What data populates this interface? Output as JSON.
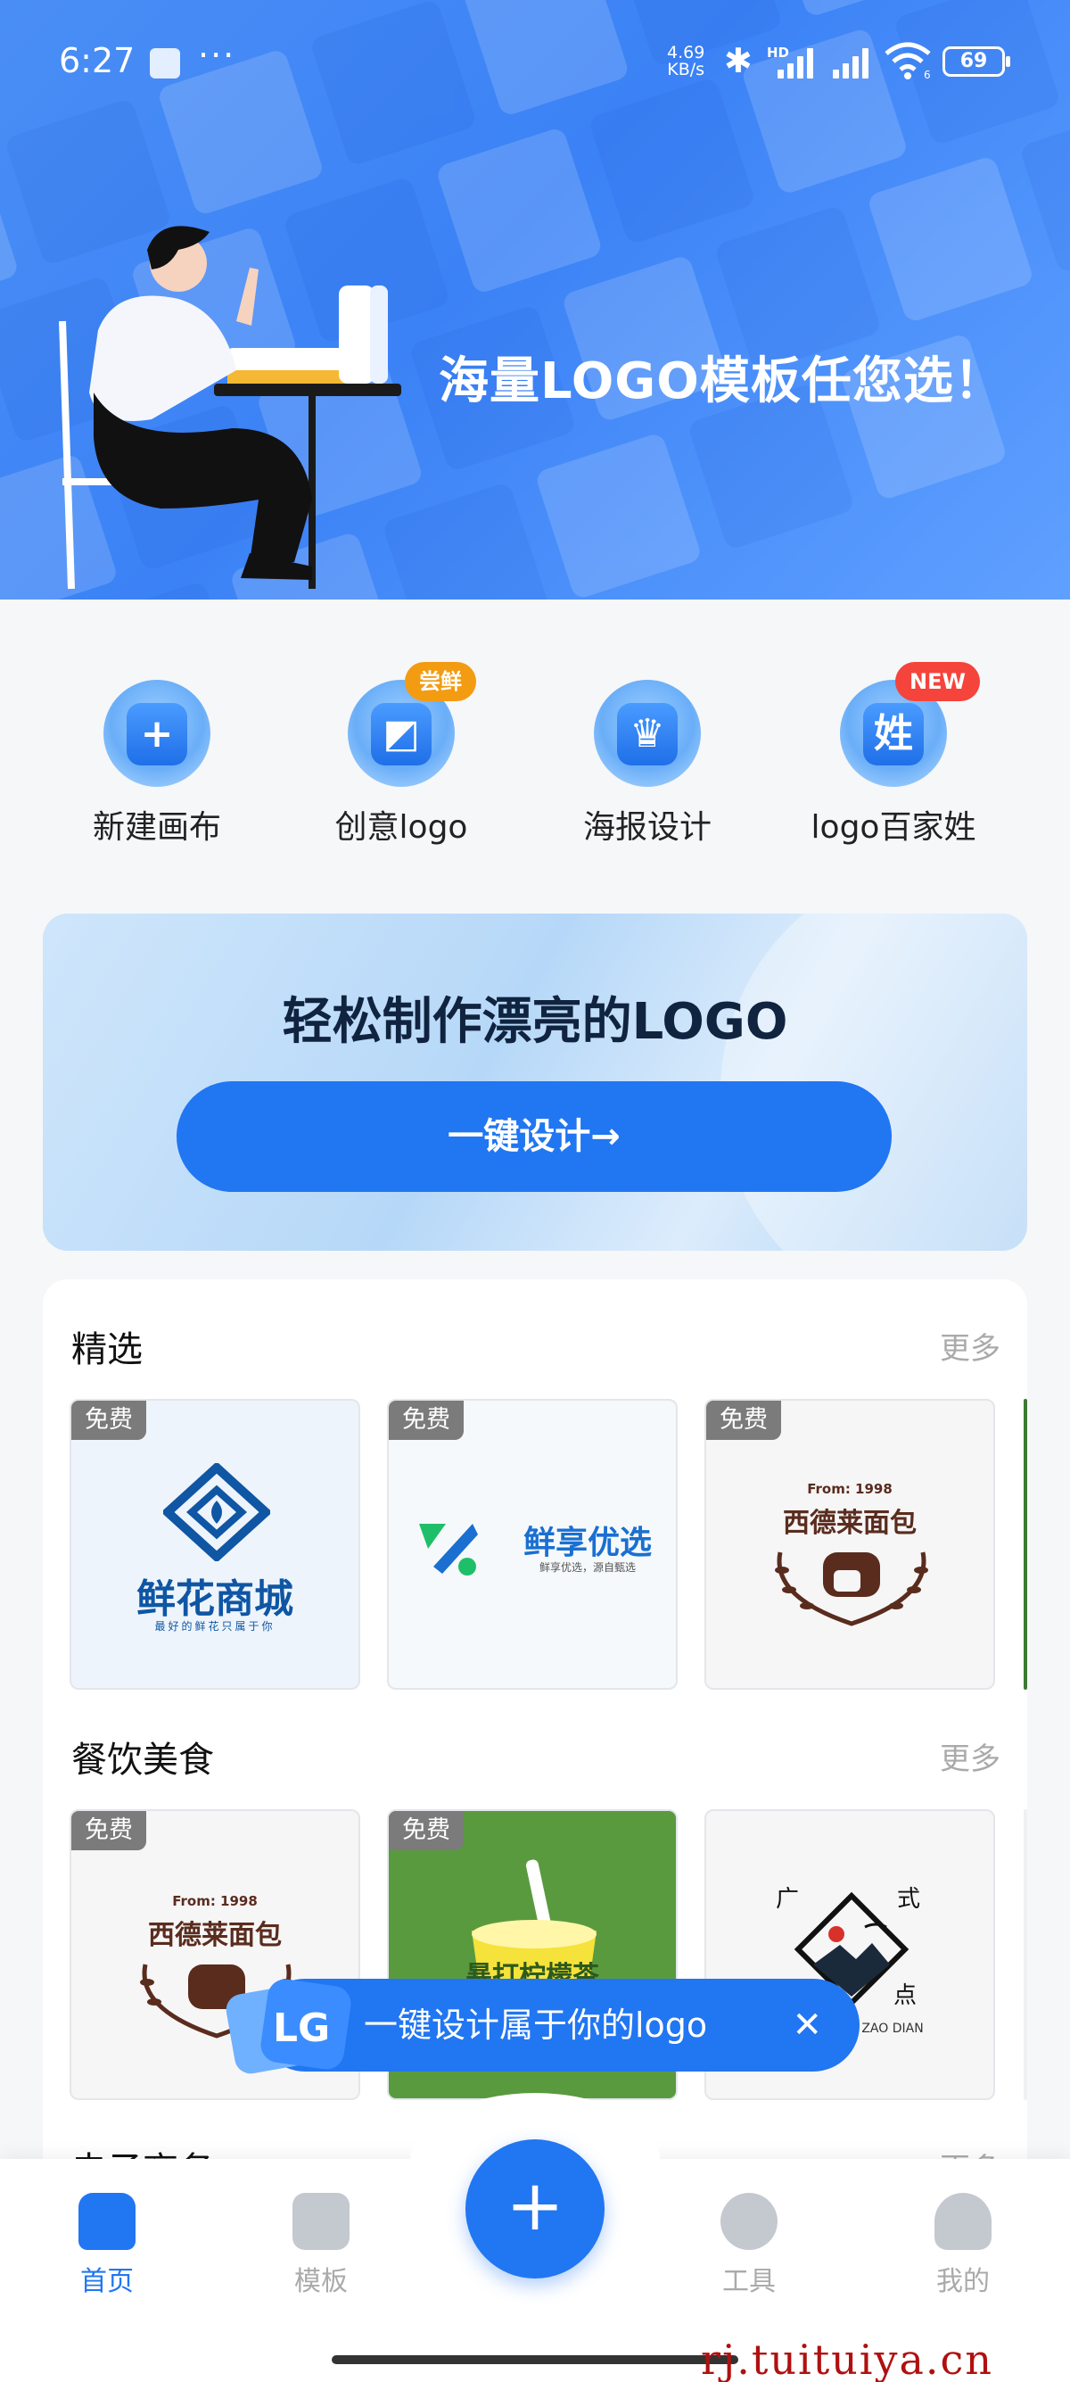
{
  "status_bar": {
    "time": "6:27",
    "net_speed_value": "4.69",
    "net_speed_unit": "KB/s",
    "sim_label": "HD",
    "wifi_sub": "6",
    "battery": "69"
  },
  "hero": {
    "title": "海量LOGO模板任您选！"
  },
  "quick_actions": [
    {
      "label": "新建画布",
      "icon": "plus-case-icon"
    },
    {
      "label": "创意logo",
      "icon": "creative-logo-icon",
      "badge": "尝鲜",
      "badge_color": "#f39c12"
    },
    {
      "label": "海报设计",
      "icon": "poster-icon"
    },
    {
      "label": "logo百家姓",
      "icon": "surname-icon",
      "badge": "NEW",
      "badge_color": "#f5443b",
      "glyph": "姓"
    }
  ],
  "promo": {
    "title": "轻松制作漂亮的LOGO",
    "button": "一键设计→"
  },
  "sections": [
    {
      "title": "精选",
      "more": "更多",
      "items": [
        {
          "free": "免费",
          "name": "鲜花商城",
          "tagline": "最好的鲜花只属于你"
        },
        {
          "free": "免费",
          "name": "鲜享优选",
          "tagline": "鲜享优选，源自甄选"
        },
        {
          "free": "免费",
          "name": "西德莱面包",
          "from": "From: 1998"
        }
      ]
    },
    {
      "title": "餐饮美食",
      "more": "更多",
      "items": [
        {
          "free": "免费",
          "name": "西德莱面包",
          "from": "From: 1998"
        },
        {
          "free": "免费",
          "name": "暴打柠檬茶"
        },
        {
          "name_top_left": "广",
          "name_top_right": "式",
          "name_bottom": "点",
          "sub": "ZAO DIAN"
        }
      ]
    },
    {
      "title": "电子商务",
      "more": "更多"
    }
  ],
  "toast": {
    "text": "一键设计属于你的logo",
    "close": "✕"
  },
  "bottom_nav": [
    {
      "label": "首页",
      "active": true
    },
    {
      "label": "模板",
      "active": false
    },
    {
      "label": "工具",
      "active": false
    },
    {
      "label": "我的",
      "active": false
    }
  ],
  "fab": "+",
  "watermark": "rj.tuituiya.cn",
  "colors": {
    "primary": "#2176f2",
    "hero": "#3b82f6",
    "badge_new": "#f5443b",
    "badge_try": "#f39c12"
  }
}
